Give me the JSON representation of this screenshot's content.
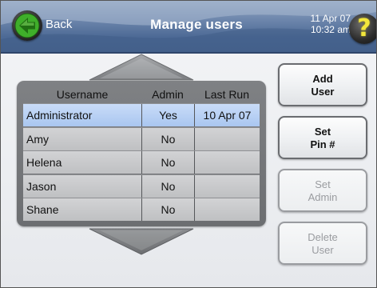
{
  "header": {
    "back_label": "Back",
    "title": "Manage users",
    "date": "11 Apr 07",
    "time": "10:32 am",
    "help_glyph": "?",
    "back_icon": "back-arrow-icon",
    "help_icon": "help-question-icon",
    "back_arrow_color": "#3fae2a",
    "help_color": "#f2e63c"
  },
  "table": {
    "columns": [
      "Username",
      "Admin",
      "Last Run"
    ],
    "rows": [
      {
        "username": "Administrator",
        "admin": "Yes",
        "last_run": "10 Apr 07",
        "selected": true
      },
      {
        "username": "Amy",
        "admin": "No",
        "last_run": "",
        "selected": false
      },
      {
        "username": "Helena",
        "admin": "No",
        "last_run": "",
        "selected": false
      },
      {
        "username": "Jason",
        "admin": "No",
        "last_run": "",
        "selected": false
      },
      {
        "username": "Shane",
        "admin": "No",
        "last_run": "",
        "selected": false
      }
    ],
    "scroll_up_icon": "scroll-up-arrow-icon",
    "scroll_down_icon": "scroll-down-arrow-icon"
  },
  "buttons": {
    "add_user": {
      "line1": "Add",
      "line2": "User",
      "enabled": true
    },
    "set_pin": {
      "line1": "Set",
      "line2": "Pin #",
      "enabled": true
    },
    "set_admin": {
      "line1": "Set",
      "line2": "Admin",
      "enabled": false
    },
    "delete_user": {
      "line1": "Delete",
      "line2": "User",
      "enabled": false
    }
  },
  "colors": {
    "header_blue": "#4d6a96",
    "selected_row": "#b8d1f4",
    "row_gray": "#c8c9cb",
    "disabled_text": "#9a9ca0"
  }
}
